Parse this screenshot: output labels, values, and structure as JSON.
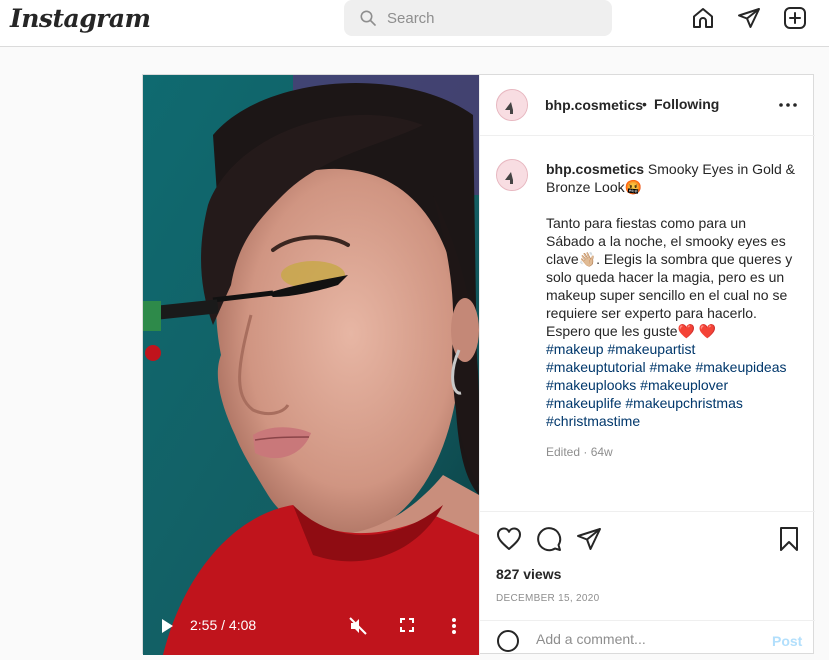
{
  "topbar": {
    "logo": "Instagram",
    "search_placeholder": "Search"
  },
  "post": {
    "username": "bhp.cosmetics",
    "separator": "•",
    "follow_status": "Following",
    "video": {
      "time": "2:55 / 4:08"
    },
    "caption": {
      "username": "bhp.cosmetics",
      "title": " Smooky Eyes in Gold & Bronze Look🤬",
      "body": "Tanto para fiestas como para un Sábado a la noche, el smooky eyes es clave👋🏼. Elegis la sombra que queres y solo queda hacer la magia, pero es un makeup super sencillo en el cual no se requiere ser experto para hacerlo. Espero que les guste❤️ ❤️",
      "hashtags": [
        "#makeup",
        "#makeupartist",
        "#makeuptutorial",
        "#make",
        "#makeupideas",
        "#makeuplooks",
        "#makeuplover",
        "#makeuplife",
        "#makeupchristmas",
        "#christmastime"
      ]
    },
    "meta": "Edited · 64w",
    "views": "827 views",
    "date": "DECEMBER 15, 2020",
    "comment_placeholder": "Add a comment...",
    "post_button": "Post"
  },
  "colors": {
    "hashtag": "#00376b",
    "muted": "#8e8e8e",
    "post_button": "#b2dffc"
  }
}
